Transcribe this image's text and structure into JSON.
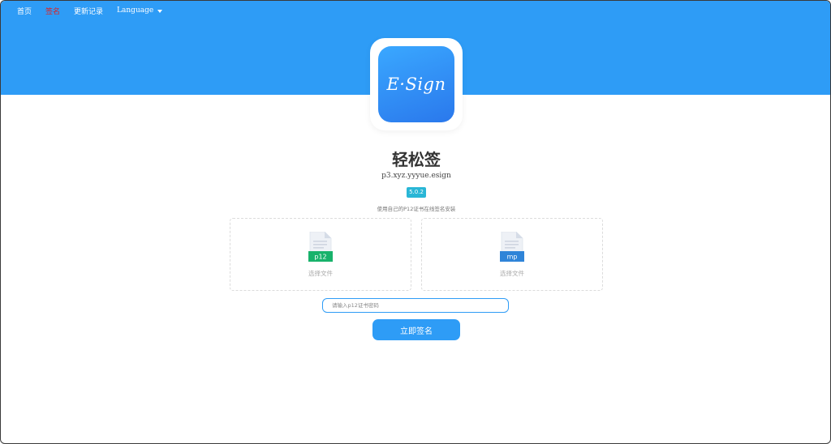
{
  "nav": {
    "items": [
      {
        "label": "首页",
        "active": false
      },
      {
        "label": "签名",
        "active": true
      },
      {
        "label": "更新记录",
        "active": false
      }
    ],
    "language_label": "Language"
  },
  "app": {
    "icon_text": "E·Sign",
    "name": "轻松签",
    "bundle_id": "p3.xyz.yyyue.esign",
    "version": "5.0.2",
    "description": "使用自己的P12证书在线签名安装"
  },
  "uploads": [
    {
      "badge": "p12",
      "badge_color": "#18b26b",
      "label": "选择文件"
    },
    {
      "badge": "mp",
      "badge_color": "#2f84d8",
      "label": "选择文件"
    }
  ],
  "password": {
    "placeholder": "请输入p12证书密码",
    "value": ""
  },
  "sign_button": {
    "label": "立即签名"
  },
  "colors": {
    "primary": "#2e9cf6",
    "active_nav": "#e02020",
    "version_badge": "#29b6d6"
  }
}
